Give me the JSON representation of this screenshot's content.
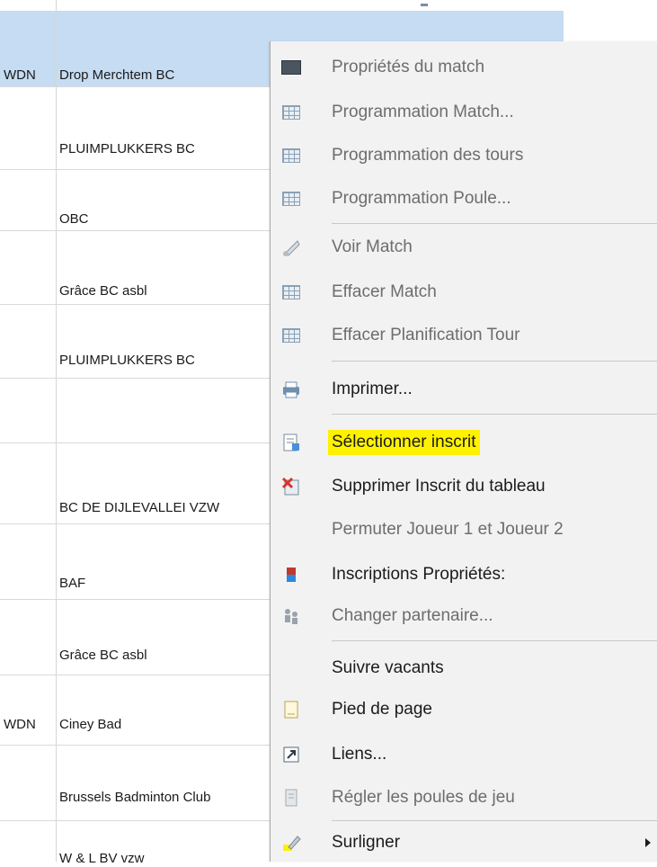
{
  "table": {
    "rows": [
      {
        "code": "WDN",
        "club": "Drop Merchtem BC"
      },
      {
        "code": "",
        "club": "PLUIMPLUKKERS BC"
      },
      {
        "code": "",
        "club": "OBC"
      },
      {
        "code": "",
        "club": "Grâce BC asbl"
      },
      {
        "code": "",
        "club": "PLUIMPLUKKERS BC"
      },
      {
        "code": "",
        "club": ""
      },
      {
        "code": "",
        "club": "BC DE DIJLEVALLEI VZW"
      },
      {
        "code": "",
        "club": "BAF"
      },
      {
        "code": "",
        "club": "Grâce BC asbl"
      },
      {
        "code": "WDN",
        "club": "Ciney Bad"
      },
      {
        "code": "",
        "club": "Brussels Badminton Club"
      },
      {
        "code": "",
        "club": "W & L BV vzw"
      }
    ]
  },
  "context_menu": {
    "items": [
      {
        "label": "Propriétés du match",
        "enabled": false,
        "icon": "match-score-icon"
      },
      {
        "label": "Programmation Match...",
        "enabled": false,
        "icon": "schedule-grid-icon"
      },
      {
        "label": "Programmation des tours",
        "enabled": false,
        "icon": "schedule-rounds-icon"
      },
      {
        "label": "Programmation Poule...",
        "enabled": false,
        "icon": "schedule-pool-icon"
      },
      {
        "label": "Voir Match",
        "enabled": false,
        "icon": "shuttlecock-icon"
      },
      {
        "label": "Effacer Match",
        "enabled": false,
        "icon": "clear-match-icon"
      },
      {
        "label": "Effacer Planification Tour",
        "enabled": false,
        "icon": "clear-rounds-icon"
      },
      {
        "label": "Imprimer...",
        "enabled": true,
        "icon": "printer-icon"
      },
      {
        "label": "Sélectionner inscrit",
        "enabled": true,
        "icon": "select-entry-icon",
        "highlighted": true
      },
      {
        "label": "Supprimer Inscrit du tableau",
        "enabled": true,
        "icon": "delete-entry-icon"
      },
      {
        "label": "Permuter Joueur 1 et Joueur 2",
        "enabled": false,
        "icon": ""
      },
      {
        "label": "Inscriptions Propriétés:",
        "enabled": true,
        "icon": "entry-properties-icon"
      },
      {
        "label": "Changer partenaire...",
        "enabled": false,
        "icon": "change-partner-icon"
      },
      {
        "label": "Suivre vacants",
        "enabled": true,
        "icon": ""
      },
      {
        "label": "Pied de page",
        "enabled": true,
        "icon": "footer-page-icon"
      },
      {
        "label": "Liens...",
        "enabled": true,
        "icon": "link-icon"
      },
      {
        "label": "Régler les poules de jeu",
        "enabled": false,
        "icon": "pool-settings-icon"
      },
      {
        "label": "Surligner",
        "enabled": true,
        "icon": "highlighter-icon",
        "has_submenu": true
      }
    ]
  },
  "colors": {
    "header_band": "#c5dcf2",
    "menu_background": "#f2f2f2",
    "highlight": "#fff200"
  }
}
